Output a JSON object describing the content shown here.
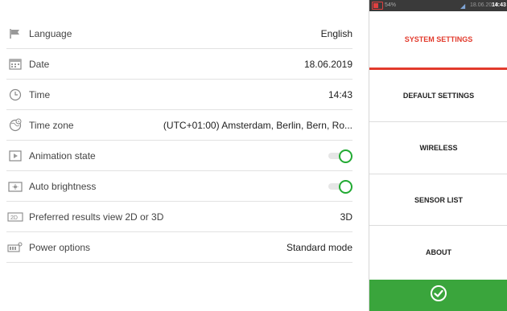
{
  "settings": [
    {
      "label": "Language",
      "value": "English",
      "icon": "flag-icon"
    },
    {
      "label": "Date",
      "value": "18.06.2019",
      "icon": "calendar-icon"
    },
    {
      "label": "Time",
      "value": "14:43",
      "icon": "clock-icon"
    },
    {
      "label": "Time zone",
      "value": "(UTC+01:00) Amsterdam, Berlin, Bern, Ro...",
      "icon": "globe-icon"
    },
    {
      "label": "Animation state",
      "toggle": true,
      "icon": "animation-icon"
    },
    {
      "label": "Auto brightness",
      "toggle": true,
      "icon": "brightness-icon"
    },
    {
      "label": "Preferred results view 2D or 3D",
      "value": "3D",
      "icon": "2d-3d-icon"
    },
    {
      "label": "Power options",
      "value": "Standard mode",
      "icon": "battery-icon"
    }
  ],
  "status_bar": {
    "battery": "54%",
    "date": "18.06.2019",
    "time": "14:43"
  },
  "menu": {
    "items": [
      {
        "label": "SYSTEM SETTINGS",
        "active": true
      },
      {
        "label": "DEFAULT SETTINGS"
      },
      {
        "label": "WIRELESS"
      },
      {
        "label": "SENSOR LIST"
      },
      {
        "label": "ABOUT"
      }
    ],
    "confirm_icon": "checkmark-icon"
  },
  "colors": {
    "accent_red": "#e23a2c",
    "toggle_green": "#22aa33",
    "confirm_green": "#3aa53c"
  }
}
